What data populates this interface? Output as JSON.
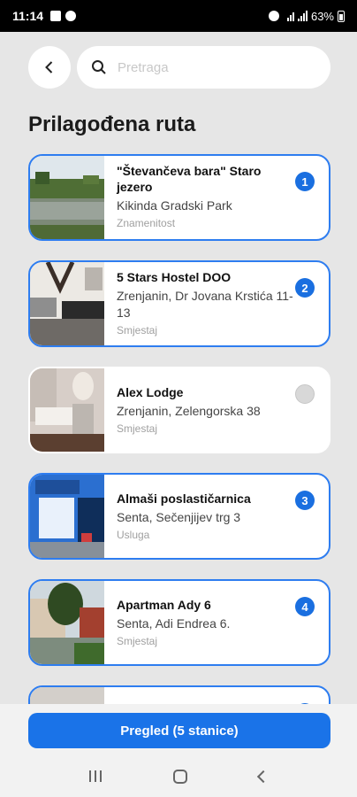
{
  "status_bar": {
    "time": "11:14",
    "battery": "63%"
  },
  "search": {
    "placeholder": "Pretraga"
  },
  "page": {
    "title": "Prilagođena ruta"
  },
  "places": [
    {
      "title": "\"Števančeva bara\" Staro jezero",
      "address": "Kikinda Gradski Park",
      "category": "Znamenitost",
      "order": "1",
      "selected": true
    },
    {
      "title": "5 Stars Hostel DOO",
      "address": "Zrenjanin, Dr Jovana Krstića 11-13",
      "category": "Smjestaj",
      "order": "2",
      "selected": true
    },
    {
      "title": "Alex Lodge",
      "address": "Zrenjanin, Zelengorska 38",
      "category": "Smjestaj",
      "order": "",
      "selected": false
    },
    {
      "title": "Almaši poslastičarnica",
      "address": "Senta, Sečenjijev trg 3",
      "category": "Usluga",
      "order": "3",
      "selected": true
    },
    {
      "title": "Apartman Ady 6",
      "address": "Senta, Adi Endrea 6.",
      "category": "Smjestaj",
      "order": "4",
      "selected": true
    }
  ],
  "footer": {
    "button_label": "Pregled (5 stanice)"
  },
  "colors": {
    "accent": "#1a73e8",
    "selected_border": "#2e7df0",
    "background": "#e6e6e6"
  }
}
